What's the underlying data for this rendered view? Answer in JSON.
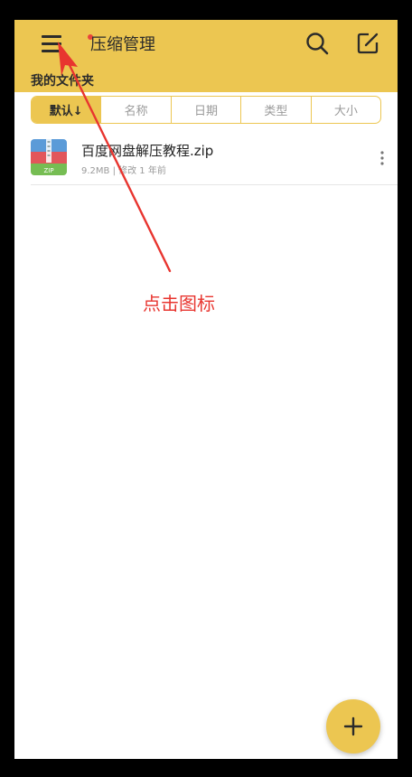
{
  "header": {
    "title": "压缩管理",
    "has_notification_dot": true
  },
  "folder_label": "我的文件夹",
  "sort_tabs": [
    {
      "label": "默认↓",
      "active": true
    },
    {
      "label": "名称",
      "active": false
    },
    {
      "label": "日期",
      "active": false
    },
    {
      "label": "类型",
      "active": false
    },
    {
      "label": "大小",
      "active": false
    }
  ],
  "files": [
    {
      "name": "百度网盘解压教程.zip",
      "meta": "9.2MB | 修改 1 年前",
      "icon": "zip-archive-icon"
    }
  ],
  "annotation": {
    "text": "点击图标",
    "color": "#e8352f"
  },
  "colors": {
    "accent": "#ecc651",
    "annotation": "#e8352f"
  }
}
